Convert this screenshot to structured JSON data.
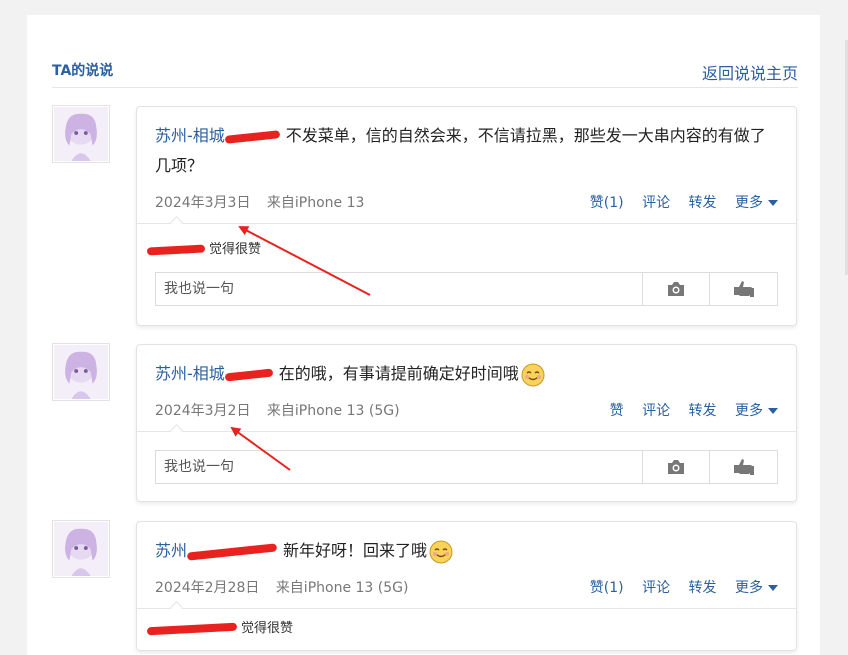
{
  "header": {
    "title": "TA的说说",
    "back_link": "返回说说主页"
  },
  "posts": [
    {
      "author": "苏州-相城",
      "text": "不发菜单，信的自然会来，不信请拉黑，那些发一大串内容的有做了几项？",
      "date": "2024年3月3日",
      "source": "来自iPhone 13",
      "like_label": "赞(1)",
      "comment_label": "评论",
      "share_label": "转发",
      "more_label": "更多",
      "likes_text": "觉得很赞",
      "comment_placeholder": "我也说一句"
    },
    {
      "author": "苏州-相城",
      "text": "在的哦，有事请提前确定好时间哦",
      "emoji": "smile-emoji",
      "date": "2024年3月2日",
      "source": "来自iPhone 13 (5G)",
      "like_label": "赞",
      "comment_label": "评论",
      "share_label": "转发",
      "more_label": "更多",
      "comment_placeholder": "我也说一句"
    },
    {
      "author": "苏州",
      "text": "新年好呀！回来了哦",
      "emoji": "smile-emoji",
      "date": "2024年2月28日",
      "source": "来自iPhone 13 (5G)",
      "like_label": "赞(1)",
      "comment_label": "评论",
      "share_label": "转发",
      "more_label": "更多",
      "likes_text": "觉得很赞"
    }
  ],
  "icons": [
    "camera-icon",
    "thumb-icon",
    "caret-down-icon",
    "smile-emoji"
  ],
  "colors": {
    "link": "#2b5fa0",
    "annotation": "#e8231f"
  }
}
